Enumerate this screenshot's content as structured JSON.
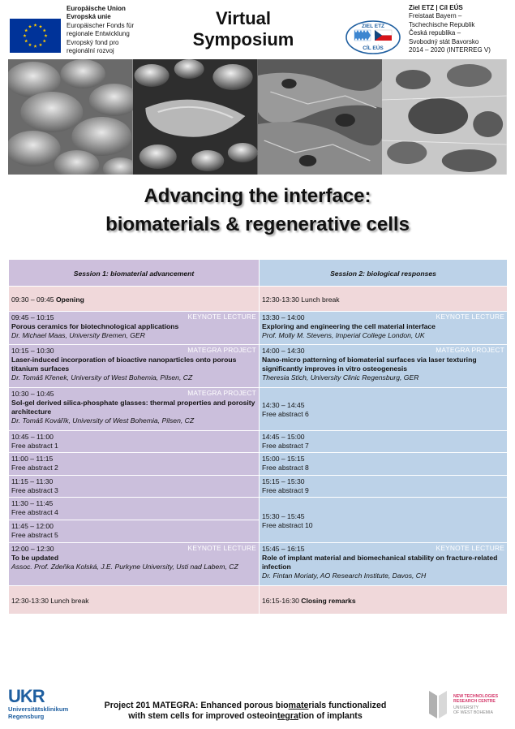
{
  "header": {
    "eu_lines": [
      {
        "text": "Europäische Union",
        "bold": true
      },
      {
        "text": "Evropská unie",
        "bold": true
      },
      {
        "text": "Europäischer Fonds für",
        "bold": false
      },
      {
        "text": "regionale Entwicklung",
        "bold": false
      },
      {
        "text": "Evropský fond pro",
        "bold": false
      },
      {
        "text": "regionální rozvoj",
        "bold": false
      }
    ],
    "title_line1": "Virtual",
    "title_line2": "Symposium",
    "ziel_logo_top": "ZIEL ETZ",
    "ziel_logo_bottom": "CÍL EÚS",
    "ziel_lines": [
      {
        "text": "Ziel ETZ | Cíl EÚS",
        "bold": true
      },
      {
        "text": "Freistaat Bayern –",
        "bold": false
      },
      {
        "text": "Tschechische Republik",
        "bold": false
      },
      {
        "text": "Česká republika –",
        "bold": false
      },
      {
        "text": "Svobodný stát Bavorsko",
        "bold": false
      },
      {
        "text": "2014 – 2020 (INTERREG V)",
        "bold": false
      }
    ]
  },
  "main_title": {
    "line1": "Advancing the interface:",
    "line2": "biomaterials & regenerative cells"
  },
  "colors": {
    "lavender": "#cbbfdc",
    "blue": "#bcd2e8",
    "pink": "#f0d8da",
    "ukr_blue": "#1f5fa0",
    "ntc_pink": "#d4386a"
  },
  "session1": {
    "header": "Session 1:  biomaterial advancement",
    "opening": {
      "time": "09:30 – 09:45",
      "label": "Opening"
    },
    "talks": [
      {
        "time": "09:45 – 10:15",
        "tag": "KEYNOTE LECTURE",
        "title": "Porous ceramics for biotechnological applications",
        "speaker": "Dr. Michael Maas, University Bremen, GER"
      },
      {
        "time": "10:15 – 10:30",
        "tag": "MATEGRA PROJECT",
        "title": "Laser-induced incorporation of bioactive nanoparticles onto porous titanium surfaces",
        "speaker": "Dr. Tomáš Křenek, University of West Bohemia, Pilsen, CZ"
      },
      {
        "time": "10:30 – 10:45",
        "tag": "MATEGRA PROJECT",
        "title": "Sol-gel derived silica-phosphate glasses: thermal properties and porosity architecture",
        "speaker": "Dr. Tomáš Kovářík, University of West Bohemia, Pilsen, CZ"
      }
    ],
    "free": [
      {
        "time": "10:45 – 11:00",
        "label": "Free abstract 1"
      },
      {
        "time": "11:00 – 11:15",
        "label": "Free abstract 2"
      },
      {
        "time": "11:15 – 11:30",
        "label": "Free abstract 3"
      },
      {
        "time": "11:30 – 11:45",
        "label": "Free abstract 4"
      },
      {
        "time": "11:45 – 12:00",
        "label": "Free abstract 5"
      }
    ],
    "last_talk": {
      "time": "12:00 – 12:30",
      "tag": "KEYNOTE LECTURE",
      "title": "To be updated",
      "speaker": "Assoc. Prof. Zdeňka Kolská, J.E. Purkyne University, Usti nad Labem, CZ"
    },
    "lunch": "12:30-13:30 Lunch break"
  },
  "session2": {
    "header": "Session 2:  biological responses",
    "lunch": "12:30-13:30 Lunch break",
    "talks": [
      {
        "time": "13:30 – 14:00",
        "tag": "KEYNOTE LECTURE",
        "title": "Exploring and engineering the cell material interface",
        "speaker": "Prof. Molly M. Stevens, Imperial College London, UK"
      },
      {
        "time": "14:00 – 14:30",
        "tag": "MATEGRA PROJECT",
        "title": "Nano-micro patterning of biomaterial surfaces via laser texturing significantly improves in vitro osteogenesis",
        "speaker": "Theresia Stich, University Clinic Regensburg, GER"
      }
    ],
    "free": [
      {
        "time": "14:30 – 14:45",
        "label": "Free abstract 6"
      },
      {
        "time": "14:45 – 15:00",
        "label": "Free abstract 7"
      },
      {
        "time": "15:00 – 15:15",
        "label": "Free abstract 8"
      },
      {
        "time": "15:15 – 15:30",
        "label": "Free abstract 9"
      },
      {
        "time": "15:30 – 15:45",
        "label": "Free abstract 10"
      }
    ],
    "last_talk": {
      "time": "15:45 – 16:15",
      "tag": "KEYNOTE LECTURE",
      "title": "Role of implant material and biomechanical stability on fracture-related infection",
      "speaker": "Dr. Fintan Moriaty, AO Research Institute, Davos, CH"
    },
    "closing": {
      "time": "16:15-16:30",
      "label": "Closing remarks"
    }
  },
  "footer": {
    "ukr_logo": "UKR",
    "ukr_line1": "Universitätsklinikum",
    "ukr_line2": "Regensburg",
    "project_line1_parts": [
      "Project 201 MATEGRA: Enhanced porous bio",
      "mate",
      "rials functionalized"
    ],
    "project_line2_parts": [
      "with stem cells for improved osteoin",
      "tegra",
      "tion of implants"
    ],
    "ntc_line1": "NEW TECHNOLOGIES",
    "ntc_line2": "RESEARCH CENTRE",
    "ntc_line3": "UNIVERSITY",
    "ntc_line4": "OF WEST BOHEMIA"
  }
}
